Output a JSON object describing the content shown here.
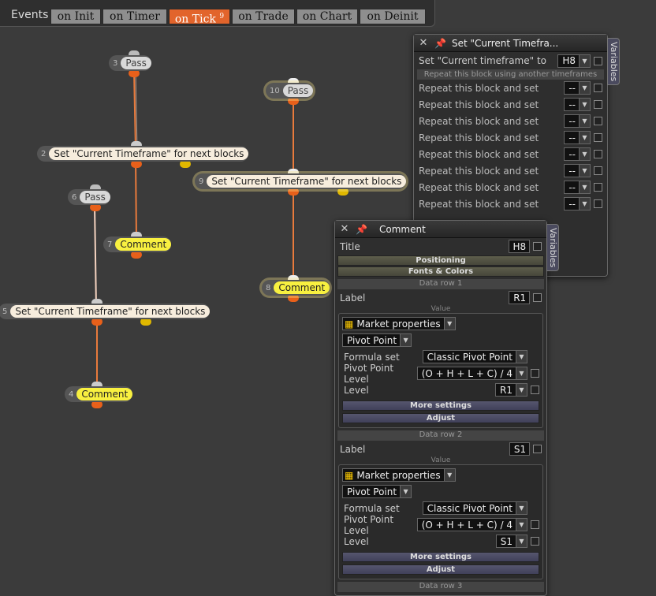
{
  "tabs": {
    "label": "Events",
    "items": [
      "on Init",
      "on Timer",
      "on Tick",
      "on Trade",
      "on Chart",
      "on Deinit"
    ],
    "active_index": 2,
    "active_badge": "9"
  },
  "nodes": {
    "n3": {
      "num": "3",
      "label": "Pass"
    },
    "n2": {
      "num": "2",
      "label": "Set \"Current Timeframe\" for next blocks"
    },
    "n7": {
      "num": "7",
      "label": "Comment"
    },
    "n6": {
      "num": "6",
      "label": "Pass"
    },
    "n5": {
      "num": "5",
      "label": "Set \"Current Timeframe\" for next blocks"
    },
    "n4": {
      "num": "4",
      "label": "Comment"
    },
    "n10": {
      "num": "10",
      "label": "Pass"
    },
    "n9": {
      "num": "9",
      "label": "Set \"Current Timeframe\" for next blocks"
    },
    "n8": {
      "num": "8",
      "label": "Comment"
    }
  },
  "panel_tf": {
    "title": "Set \"Current Timefra...",
    "side_tab": "Variables",
    "row_label": "Set \"Current timeframe\" to",
    "row_value": "H8",
    "section": "Repeat this block using another timeframes",
    "repeat_label": "Repeat this block and set",
    "repeat_value": "--",
    "repeat_rows": 8
  },
  "panel_comment": {
    "title": "Comment",
    "side_tab": "Variables",
    "title_label": "Title",
    "title_value": "H8",
    "positioning": "Positioning",
    "fonts_colors": "Fonts & Colors",
    "value_caption": "Value",
    "rows": [
      {
        "header": "Data row 1",
        "label": "Label",
        "label_value": "R1",
        "source": "Market properties",
        "indicator": "Pivot Point",
        "formula_label": "Formula set",
        "formula_value": "Classic Pivot Point",
        "pp_level_label": "Pivot Point Level",
        "pp_level_value": "(O + H + L + C) / 4",
        "level_label": "Level",
        "level_value": "R1",
        "more": "More settings",
        "adjust": "Adjust"
      },
      {
        "header": "Data row 2",
        "label": "Label",
        "label_value": "S1",
        "source": "Market properties",
        "indicator": "Pivot Point",
        "formula_label": "Formula set",
        "formula_value": "Classic Pivot Point",
        "pp_level_label": "Pivot Point Level",
        "pp_level_value": "(O + H + L + C) / 4",
        "level_label": "Level",
        "level_value": "S1",
        "more": "More settings",
        "adjust": "Adjust"
      }
    ],
    "next_header": "Data row 3"
  },
  "colors": {
    "accent": "#e2642b",
    "comment": "#f8f040",
    "wire": "#e87a3c"
  }
}
